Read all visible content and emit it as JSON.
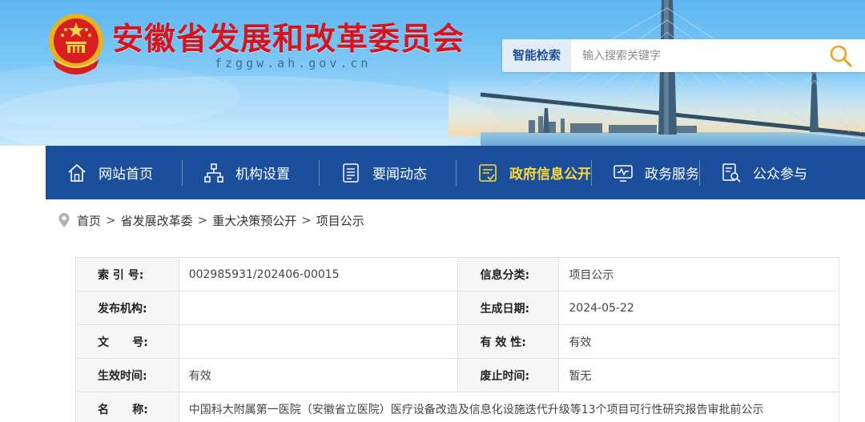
{
  "header": {
    "site_title": "安徽省发展和改革委员会",
    "site_domain": "fzggw.ah.gov.cn",
    "emblem_icon": "national-emblem-icon",
    "colors": {
      "title_red": "#d5141e",
      "sky_blue": "#5cb6f3",
      "nav_blue": "#1c4f9b",
      "active_yellow": "#ffd83a"
    }
  },
  "search": {
    "label": "智能检索",
    "placeholder": "输入搜索关键字",
    "button_icon": "search-icon",
    "value": ""
  },
  "nav": {
    "items": [
      {
        "label": "网站首页",
        "icon": "home-icon",
        "active": false
      },
      {
        "label": "机构设置",
        "icon": "org-chart-icon",
        "active": false
      },
      {
        "label": "要闻动态",
        "icon": "news-icon",
        "active": false
      },
      {
        "label": "政府信息公开",
        "icon": "info-disclosure-icon",
        "active": true
      },
      {
        "label": "政务服务",
        "icon": "service-monitor-icon",
        "active": false
      },
      {
        "label": "公众参与",
        "icon": "public-participation-icon",
        "active": false
      }
    ]
  },
  "breadcrumb": {
    "icon": "location-pin-icon",
    "items": [
      "首页",
      "省发展改革委",
      "重大决策预公开",
      "项目公示"
    ],
    "separator": ">"
  },
  "info_table": {
    "rows": [
      {
        "label1": "索 引 号:",
        "value1": "002985931/202406-00015",
        "label2": "信息分类:",
        "value2": "项目公示"
      },
      {
        "label1": "发布机构:",
        "value1": "",
        "label2": "生成日期:",
        "value2": "2024-05-22"
      },
      {
        "label1": "文      号:",
        "value1": "",
        "label2": "有 效 性:",
        "value2": "有效"
      },
      {
        "label1": "生效时间:",
        "value1": "有效",
        "label2": "废止时间:",
        "value2": "暂无"
      }
    ],
    "name_row": {
      "label": "名      称:",
      "value": "中国科大附属第一医院（安徽省立医院）医疗设备改造及信息化设施迭代升级等13个项目可行性研究报告审批前公示"
    }
  }
}
